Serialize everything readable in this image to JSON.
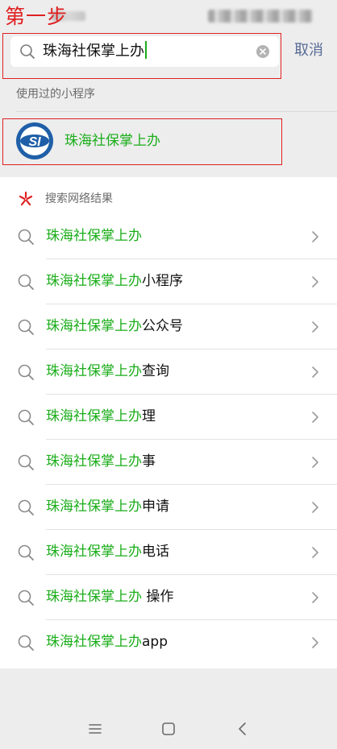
{
  "annotation": {
    "step_label": "第一步"
  },
  "search": {
    "query": "珠海社保掌上办",
    "cancel_label": "取消"
  },
  "used_section": {
    "label": "使用过的小程序",
    "items": [
      {
        "name": "珠海社保掌上办",
        "logo_text": "SI"
      }
    ]
  },
  "web_results": {
    "title": "搜索网络结果",
    "items": [
      {
        "highlight": "珠海社保掌上办",
        "suffix": ""
      },
      {
        "highlight": "珠海社保掌上办",
        "suffix": "小程序"
      },
      {
        "highlight": "珠海社保掌上办",
        "suffix": "公众号"
      },
      {
        "highlight": "珠海社保掌上办",
        "suffix": "查询"
      },
      {
        "highlight": "珠海社保掌上办",
        "suffix": "理"
      },
      {
        "highlight": "珠海社保掌上办",
        "suffix": "事"
      },
      {
        "highlight": "珠海社保掌上办",
        "suffix": "申请"
      },
      {
        "highlight": "珠海社保掌上办",
        "suffix": "电话"
      },
      {
        "highlight": "珠海社保掌上办",
        "suffix": " 操作"
      },
      {
        "highlight": "珠海社保掌上办",
        "suffix": "app"
      }
    ]
  },
  "colors": {
    "accent_green": "#1aad19",
    "link_blue": "#576b95",
    "annotation_red": "#e02020",
    "logo_blue": "#1f5fa8"
  },
  "nav_bar": {
    "icons": [
      "menu-icon",
      "home-icon",
      "back-icon"
    ]
  }
}
